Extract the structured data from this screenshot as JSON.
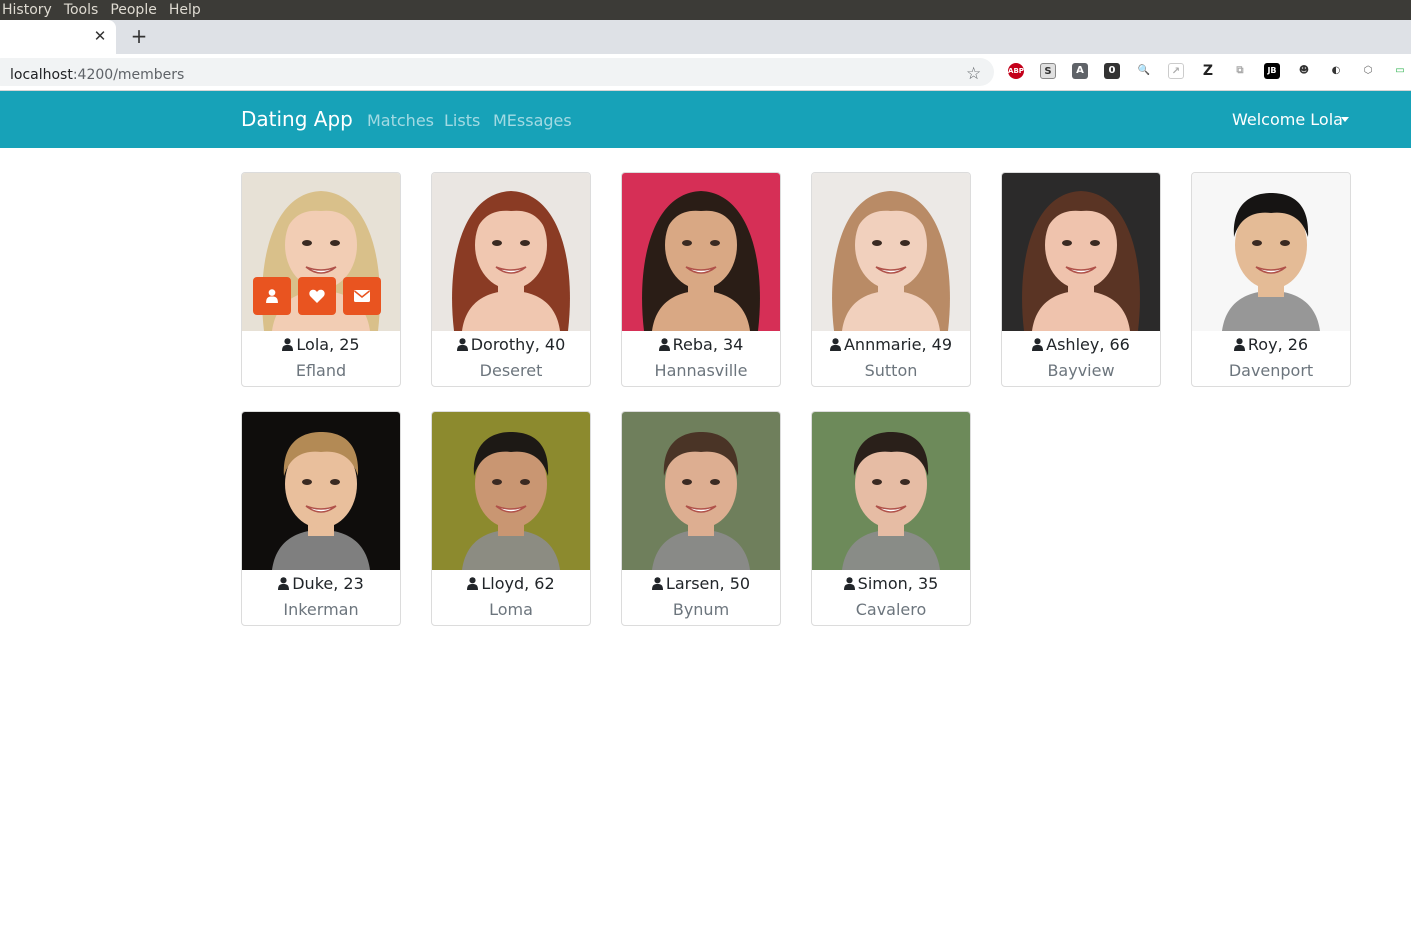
{
  "os_menu": [
    "History",
    "Tools",
    "People",
    "Help"
  ],
  "browser": {
    "tab_close": "✕",
    "new_tab": "+",
    "url_host": "localhost",
    "url_path": ":4200/members",
    "star": "☆",
    "extensions": [
      "ABP",
      "S",
      "A",
      "0",
      "🔍",
      "↗",
      "Z",
      "⧉",
      "JB",
      "☻",
      "◐",
      "⬡",
      "▭"
    ]
  },
  "navbar": {
    "brand": "Dating App",
    "links": [
      "Matches",
      "Lists",
      "MEssages"
    ],
    "welcome": "Welcome Lola",
    "bg_color": "#17a2b8"
  },
  "members": [
    {
      "name": "Lola, 25",
      "city": "Efland",
      "hair": "#d9c08a",
      "skin": "#f2cdb4",
      "bg": "#e7e1d6"
    },
    {
      "name": "Dorothy, 40",
      "city": "Deseret",
      "hair": "#8a3b24",
      "skin": "#f0c7b0",
      "bg": "#eae6e2"
    },
    {
      "name": "Reba, 34",
      "city": "Hannasville",
      "hair": "#2a1d16",
      "skin": "#d9a884",
      "bg": "#d62f56"
    },
    {
      "name": "Annmarie, 49",
      "city": "Sutton",
      "hair": "#b98b66",
      "skin": "#f1d0bd",
      "bg": "#ece9e6"
    },
    {
      "name": "Ashley, 66",
      "city": "Bayview",
      "hair": "#5a3424",
      "skin": "#efc3ad",
      "bg": "#2b2a2a"
    },
    {
      "name": "Roy, 26",
      "city": "Davenport",
      "hair": "#161413",
      "skin": "#e4bb96",
      "bg": "#f7f7f7"
    },
    {
      "name": "Duke, 23",
      "city": "Inkerman",
      "hair": "#b38a55",
      "skin": "#e9bf9c",
      "bg": "#0f0d0c"
    },
    {
      "name": "Lloyd, 62",
      "city": "Loma",
      "hair": "#1d1915",
      "skin": "#c99672",
      "bg": "#8c8a2e"
    },
    {
      "name": "Larsen, 50",
      "city": "Bynum",
      "hair": "#4a3426",
      "skin": "#ddae91",
      "bg": "#6f7f5c"
    },
    {
      "name": "Simon, 35",
      "city": "Cavalero",
      "hair": "#2a201a",
      "skin": "#e6bca4",
      "bg": "#6d8a5a"
    }
  ],
  "hover_actions": [
    "user-icon",
    "heart-icon",
    "envelope-icon"
  ],
  "accent_color": "#e95420"
}
